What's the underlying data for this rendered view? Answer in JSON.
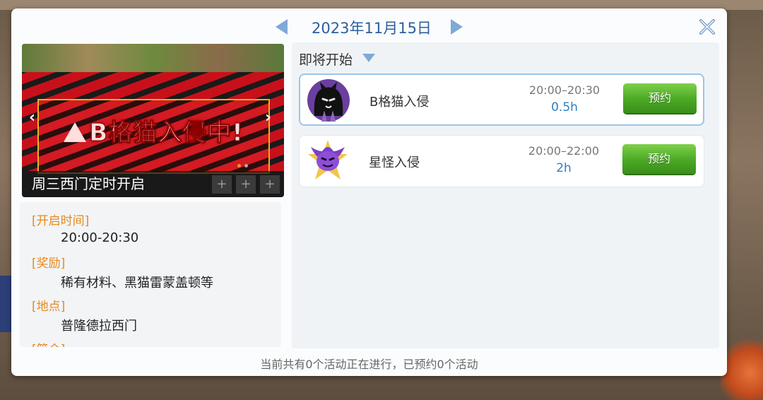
{
  "date": {
    "text": "2023年11月15日"
  },
  "banner": {
    "title": "B格猫入侵中!",
    "caption": "周三西门定时开启",
    "prev_glyph": "‹",
    "next_glyph": "›",
    "slot_glyph": "+"
  },
  "info": {
    "open_time_label": "[开启时间]",
    "open_time_value": "20:00-20:30",
    "reward_label": "[奖励]",
    "reward_value": "稀有材料、黑猫雷蒙盖顿等",
    "location_label": "[地点]",
    "location_value": "普隆德拉西门",
    "intro_label": "[简介]"
  },
  "list": {
    "header": "即将开始",
    "events": [
      {
        "name": "B格猫入侵",
        "time": "20:00–20:30",
        "duration": "0.5h",
        "button": "预约",
        "icon": "black-cat-icon",
        "selected": true
      },
      {
        "name": "星怪入侵",
        "time": "20:00–22:00",
        "duration": "2h",
        "button": "预约",
        "icon": "purple-star-monster-icon",
        "selected": false
      }
    ]
  },
  "footer": {
    "status": "当前共有0个活动正在进行，已预约0个活动"
  },
  "colors": {
    "accent": "#2c5f9c",
    "label_orange": "#e68a1e",
    "button_green": "#4aa824",
    "duration_blue": "#2e7fc0"
  }
}
